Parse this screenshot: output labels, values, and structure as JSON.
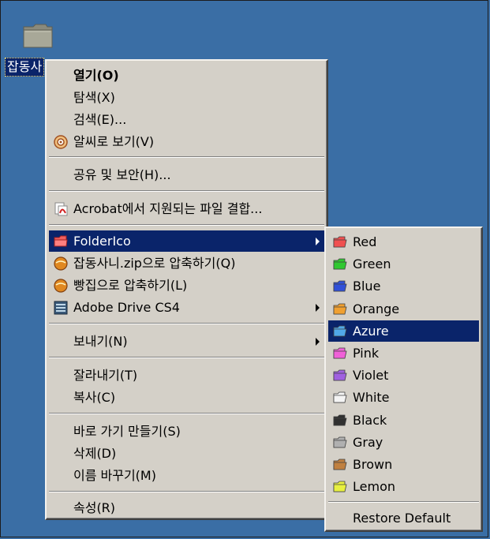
{
  "desktop": {
    "folder_label": "잡동사",
    "folder_icon": "folder-icon"
  },
  "context_menu": {
    "items": [
      {
        "label": "열기(O)",
        "bold": true
      },
      {
        "label": "탐색(X)"
      },
      {
        "label": "검색(E)..."
      },
      {
        "label": "알씨로 보기(V)",
        "icon": "alsee-icon"
      },
      {
        "label": "공유 및 보안(H)..."
      },
      {
        "label": "Acrobat에서 지원되는 파일 결합...",
        "icon": "acrobat-icon"
      },
      {
        "label": "FolderIco",
        "icon": "foldericon-icon",
        "submenu": true,
        "highlighted": true
      },
      {
        "label": "잡동사니.zip으로 압축하기(Q)",
        "icon": "bandizip-icon"
      },
      {
        "label": "빵집으로 압축하기(L)",
        "icon": "bandizip-icon"
      },
      {
        "label": "Adobe Drive CS4",
        "icon": "adobe-drive-icon",
        "submenu": true
      },
      {
        "label": "보내기(N)",
        "submenu": true
      },
      {
        "label": "잘라내기(T)"
      },
      {
        "label": "복사(C)"
      },
      {
        "label": "바로 가기 만들기(S)"
      },
      {
        "label": "삭제(D)"
      },
      {
        "label": "이름 바꾸기(M)"
      },
      {
        "label": "속성(R)"
      }
    ]
  },
  "folder_color_submenu": {
    "items": [
      {
        "label": "Red",
        "color": "#f05050"
      },
      {
        "label": "Green",
        "color": "#30c830"
      },
      {
        "label": "Blue",
        "color": "#3050d8"
      },
      {
        "label": "Orange",
        "color": "#f0a030"
      },
      {
        "label": "Azure",
        "color": "#50a8e8",
        "highlighted": true
      },
      {
        "label": "Pink",
        "color": "#f060d8"
      },
      {
        "label": "Violet",
        "color": "#a060e0"
      },
      {
        "label": "White",
        "color": "#f4f4f4"
      },
      {
        "label": "Black",
        "color": "#303030"
      },
      {
        "label": "Gray",
        "color": "#b0b0b0"
      },
      {
        "label": "Brown",
        "color": "#c08040"
      },
      {
        "label": "Lemon",
        "color": "#e8f040"
      }
    ],
    "restore_default": "Restore Default"
  }
}
